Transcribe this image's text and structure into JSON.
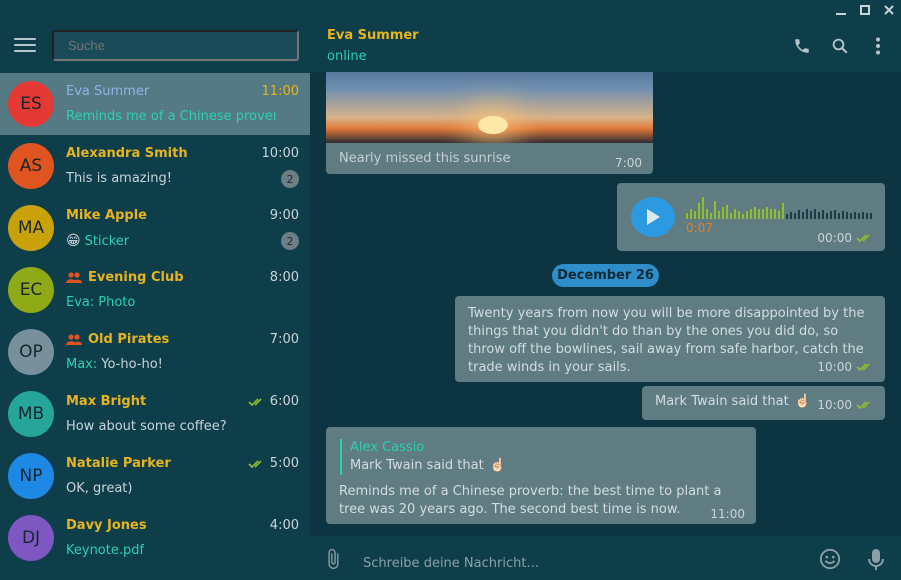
{
  "window": {
    "minimize": "—",
    "maximize": "☐",
    "close": "✕"
  },
  "sidebar": {
    "search_placeholder": "Suche",
    "chats": [
      {
        "initials": "ES",
        "name": "Eva Summer",
        "time": "11:00",
        "preview": "Reminds me of a Chinese prover...",
        "avatar_color": "#e53935",
        "active": true
      },
      {
        "initials": "AS",
        "name": "Alexandra Smith",
        "time": "10:00",
        "preview": "This is amazing!",
        "badge": "2",
        "avatar_color": "#e0541f"
      },
      {
        "initials": "MA",
        "name": "Mike Apple",
        "time": "9:00",
        "preview_emoji": "😁",
        "preview": "Sticker",
        "badge": "2",
        "avatar_color": "#c9a20a"
      },
      {
        "initials": "EC",
        "name": "Evening Club",
        "time": "8:00",
        "sender": "Eva:",
        "preview": "Photo",
        "group": true,
        "avatar_color": "#8faa16"
      },
      {
        "initials": "OP",
        "name": "Old Pirates",
        "time": "7:00",
        "sender": "Max:",
        "preview": "Yo-ho-ho!",
        "group": true,
        "avatar_color": "#78909c"
      },
      {
        "initials": "MB",
        "name": "Max Bright",
        "time": "6:00",
        "preview": "How about some coffee?",
        "read": true,
        "avatar_color": "#26a69a"
      },
      {
        "initials": "NP",
        "name": "Natalie Parker",
        "time": "5:00",
        "preview": "OK, great)",
        "read": true,
        "avatar_color": "#1e88e5"
      },
      {
        "initials": "DJ",
        "name": "Davy Jones",
        "time": "4:00",
        "preview": "Keynote.pdf",
        "avatar_color": "#7e57c2"
      }
    ]
  },
  "header": {
    "name": "Eva Summer",
    "status": "online"
  },
  "messages": {
    "image": {
      "caption": "Nearly missed this sunrise",
      "time": "7:00"
    },
    "voice": {
      "duration": "0:07",
      "time": "00:00"
    },
    "date_divider": "December 26",
    "long_text": {
      "text": "Twenty years from now you will be more disappointed by the things that you didn't do than by the ones you did do, so throw off the bowlines, sail away from safe harbor, catch the trade winds in your sails.",
      "time": "10:00"
    },
    "short_text": {
      "text": "Mark Twain said that",
      "emoji": "☝🏻",
      "time": "10:00"
    },
    "reply": {
      "quote_author": "Alex Cassio",
      "quote_text": "Mark Twain said that",
      "quote_emoji": "☝🏻",
      "text": "Reminds me of a Chinese proverb: the best time to plant a tree was 20 years ago. The second best time is now.",
      "time": "11:00"
    }
  },
  "composer": {
    "placeholder": "Schreibe deine Nachricht..."
  },
  "colors": {
    "accent": "#e6b422",
    "teal": "#2ad1b2",
    "blue": "#2b9ae0",
    "check": "#8fbf2a"
  }
}
